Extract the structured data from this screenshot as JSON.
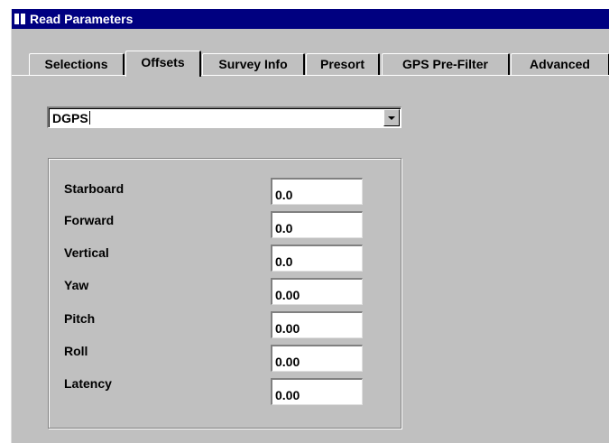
{
  "window": {
    "title": "Read Parameters"
  },
  "tabs": [
    {
      "label": "Selections",
      "active": false
    },
    {
      "label": "Offsets",
      "active": true
    },
    {
      "label": "Survey Info",
      "active": false
    },
    {
      "label": "Presort",
      "active": false
    },
    {
      "label": "GPS Pre-Filter",
      "active": false
    },
    {
      "label": "Advanced",
      "active": false
    }
  ],
  "offsets": {
    "source_select": {
      "value": "DGPS",
      "icon": "chevron-down-icon"
    },
    "fields": [
      {
        "label": "Starboard",
        "value": "0.0"
      },
      {
        "label": "Forward",
        "value": "0.0"
      },
      {
        "label": "Vertical",
        "value": "0.0"
      },
      {
        "label": "Yaw",
        "value": "0.00"
      },
      {
        "label": "Pitch",
        "value": "0.00"
      },
      {
        "label": "Roll",
        "value": "0.00"
      },
      {
        "label": "Latency",
        "value": "0.00"
      }
    ]
  },
  "colors": {
    "titlebar": "#000080",
    "face": "#c0c0c0"
  }
}
